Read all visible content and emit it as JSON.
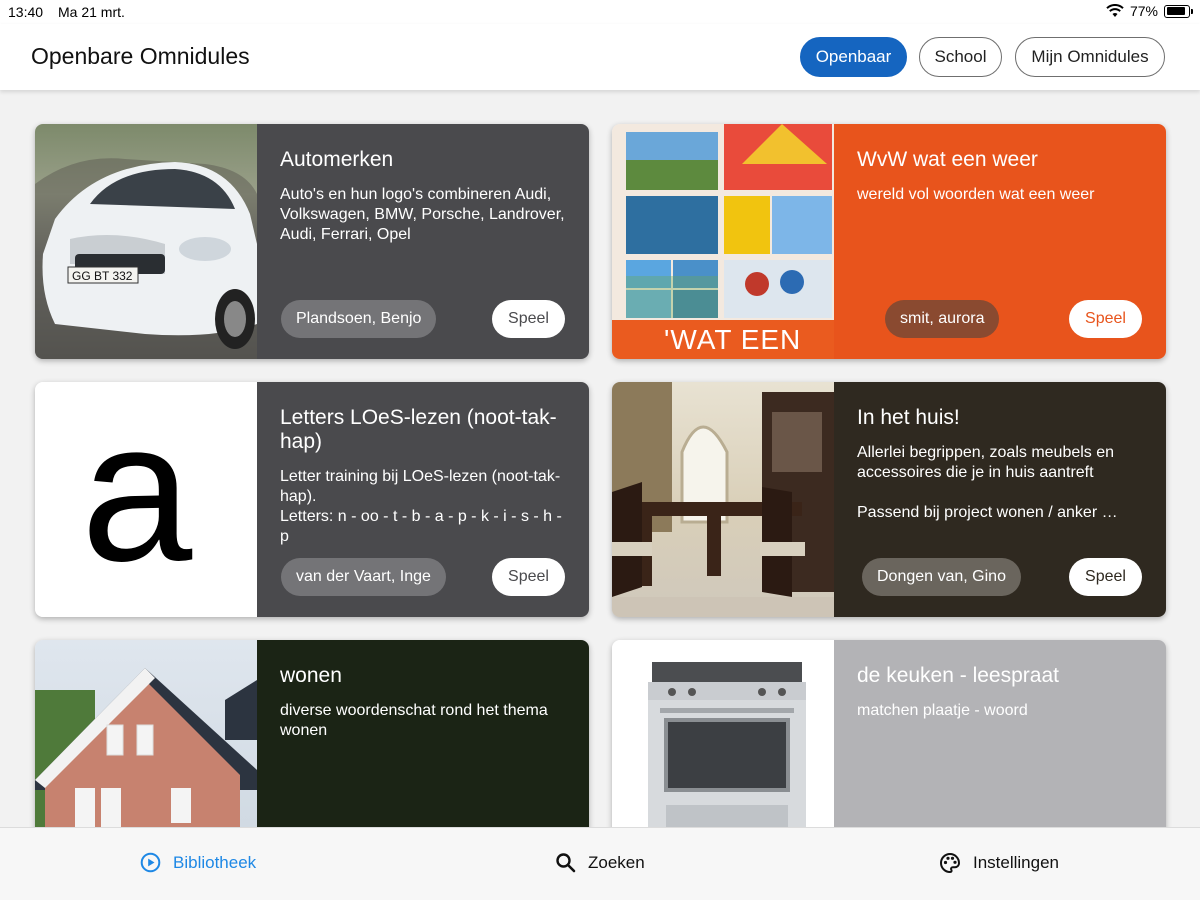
{
  "status": {
    "time": "13:40",
    "date": "Ma 21 mrt.",
    "battery": "77%"
  },
  "header": {
    "title": "Openbare Omnidules",
    "tabs": [
      {
        "label": "Openbaar",
        "active": true
      },
      {
        "label": "School",
        "active": false
      },
      {
        "label": "Mijn Omnidules",
        "active": false
      }
    ]
  },
  "cards": [
    {
      "title": "Automerken",
      "description": "Auto's en hun logo's combineren Audi, Volkswagen, BMW, Porsche, Landrover, Audi, Ferrari, Opel",
      "author": "Plandsoen, Benjo",
      "play": "Speel",
      "image": "car-photo",
      "bg": "#4a4a4d"
    },
    {
      "title": "WvW wat een weer",
      "description": "wereld vol woorden wat een weer",
      "author": "smit, aurora",
      "play": "Speel",
      "image": "weather-collage",
      "image_text": "'WAT EEN",
      "bg": "#e8541c"
    },
    {
      "title": "Letters LOeS-lezen (noot-tak-hap)",
      "description": "Letter training bij LOeS-lezen (noot-tak-hap).\nLetters: n - oo - t - b - a - p - k - i - s - h - p",
      "author": "van der Vaart, Inge",
      "play": "Speel",
      "image": "letter-a",
      "image_text": "a",
      "bg": "#4a4a4d"
    },
    {
      "title": "In het huis!",
      "description": "Allerlei begrippen, zoals meubels en accessoires die je in huis aantreft\n\nPassend  bij project wonen / anker …",
      "author": "Dongen van, Gino",
      "play": "Speel",
      "image": "dining-room-photo",
      "bg": "#2f2920"
    },
    {
      "title": "wonen",
      "description": "diverse woordenschat rond het thema wonen",
      "author": "",
      "play": "",
      "image": "house-photo",
      "bg": "#1b2415"
    },
    {
      "title": "de keuken - leespraat",
      "description": "matchen plaatje - woord",
      "author": "",
      "play": "",
      "image": "stove-photo",
      "bg": "#b3b3b6"
    }
  ],
  "nav": [
    {
      "label": "Bibliotheek",
      "icon": "play-circle-icon",
      "active": true
    },
    {
      "label": "Zoeken",
      "icon": "search-icon",
      "active": false
    },
    {
      "label": "Instellingen",
      "icon": "palette-icon",
      "active": false
    }
  ],
  "colors": {
    "primary": "#1565c0",
    "nav_active": "#1e88e5"
  }
}
